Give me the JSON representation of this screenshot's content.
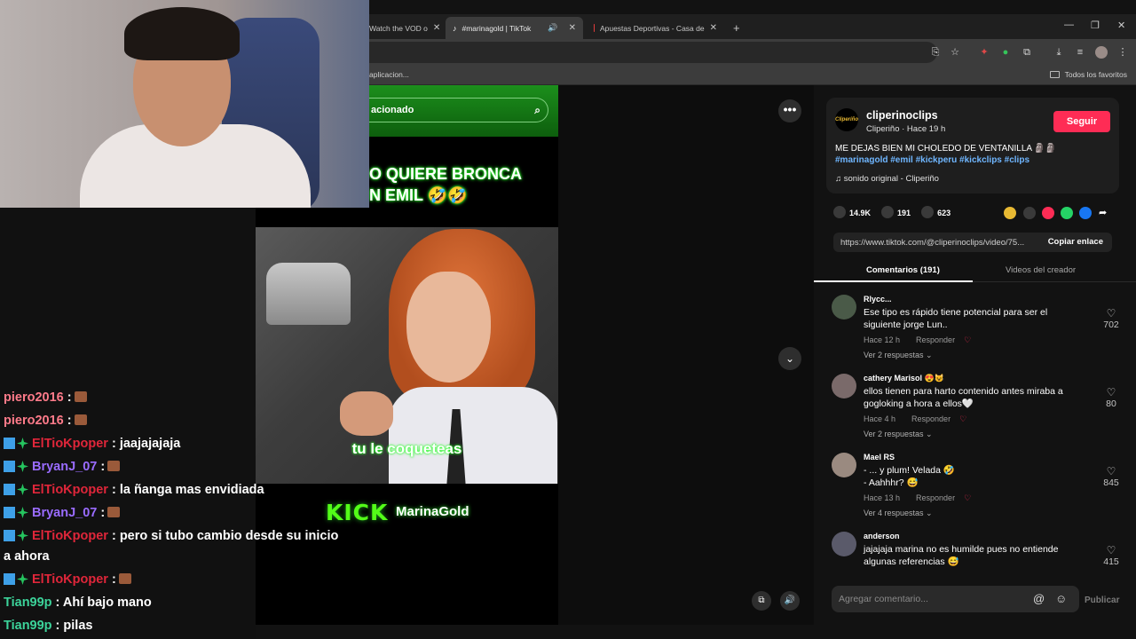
{
  "browser": {
    "tabs": [
      {
        "label": "Watch the VOD o"
      },
      {
        "label": "#marinagold | TikTok"
      },
      {
        "label": "Apuestas Deportivas - Casa de"
      }
    ],
    "close_glyph": "✕",
    "new_tab_glyph": "+",
    "bookmark_left": "aplicacion...",
    "bookmark_right": "Todos los favoritos"
  },
  "video": {
    "search_text": "acionado",
    "caption": "O QUIERE BRONCA\nN EMIL 🤣🤣",
    "subtitle": "tu le coqueteas",
    "kick_logo": "KICK",
    "kick_name": "MarinaGold"
  },
  "chat": {
    "lines": [
      {
        "user": "piero2016",
        "text": " :",
        "color": "#ff7b8a",
        "badges": false,
        "emote": true
      },
      {
        "user": "piero2016",
        "text": " :",
        "color": "#ff7b8a",
        "badges": false,
        "emote": true
      },
      {
        "user": "ElTioKpoper",
        "text": " : jaajajajaja",
        "color": "#e0263a",
        "badges": true,
        "emote": false
      },
      {
        "user": "BryanJ_07",
        "text": " :",
        "color": "#9a6cff",
        "badges": true,
        "emote": true
      },
      {
        "user": "ElTioKpoper",
        "text": " : la ñanga mas envidiada",
        "color": "#e0263a",
        "badges": true,
        "emote": false
      },
      {
        "user": "BryanJ_07",
        "text": " :",
        "color": "#9a6cff",
        "badges": true,
        "emote": true
      },
      {
        "user": "ElTioKpoper",
        "text": " : pero si tubo cambio desde su inicio",
        "color": "#e0263a",
        "badges": true,
        "emote": false
      },
      {
        "user": "",
        "text": "a ahora",
        "color": "#ffffff",
        "badges": false,
        "emote": false
      },
      {
        "user": "ElTioKpoper",
        "text": " :",
        "color": "#e0263a",
        "badges": true,
        "emote": true
      },
      {
        "user": "Tian99p",
        "text": " : Ahí bajo mano",
        "color": "#3cd39a",
        "badges": false,
        "emote": false
      },
      {
        "user": "Tian99p",
        "text": " : pilas",
        "color": "#3cd39a",
        "badges": false,
        "emote": false
      }
    ]
  },
  "post": {
    "logo_text": "Cliperiño",
    "username": "cliperinoclips",
    "meta": "Cliperiño · Hace 19 h",
    "follow_label": "Seguir",
    "description": "ME DEJAS BIEN MI CHOLEDO DE VENTANILLA 🗿🗿",
    "hashtags": "#marinagold #emil #kickperu #kickclips #clips",
    "sound": "sonido original - Cliperiño",
    "likes": "14.9K",
    "comments_count": "191",
    "saves": "623",
    "link_url": "https://www.tiktok.com/@cliperinoclips/video/75...",
    "copy_label": "Copiar enlace",
    "share_colors": [
      "#e8b933",
      "#3a3a3a",
      "#fe2c55",
      "#25d366",
      "#1877f2"
    ]
  },
  "tabs": {
    "comments_label": "Comentarios (191)",
    "videos_label": "Videos del creador"
  },
  "comments": [
    {
      "user": "Rlycc...",
      "text": "Ese tipo es rápido tiene potencial para ser el siguiente jorge Lun..",
      "time": "Hace 12 h",
      "reply_label": "Responder",
      "replies": "Ver 2 respuestas ⌄",
      "likes": "702",
      "avatar_color": "#4a5a48"
    },
    {
      "user": "cathery Marisol 😍😺",
      "text": "ellos tienen para harto contenido antes miraba a gogloking a hora a ellos🤍",
      "time": "Hace 4 h",
      "reply_label": "Responder",
      "replies": "Ver 2 respuestas ⌄",
      "likes": "80",
      "avatar_color": "#7a6a6a"
    },
    {
      "user": "Mael RS",
      "text": "- ... y plum! Velada 🤣\n- Aahhhr? 😅",
      "time": "Hace 13 h",
      "reply_label": "Responder",
      "replies": "Ver 4 respuestas ⌄",
      "likes": "845",
      "avatar_color": "#9a8a80"
    },
    {
      "user": "anderson",
      "text": "jajajaja marina no es humilde pues no entiende algunas referencias 😅",
      "time": "",
      "reply_label": "",
      "replies": "",
      "likes": "415",
      "avatar_color": "#5a5a6a"
    }
  ],
  "comment_box": {
    "placeholder": "Agregar comentario...",
    "publish_label": "Publicar"
  }
}
